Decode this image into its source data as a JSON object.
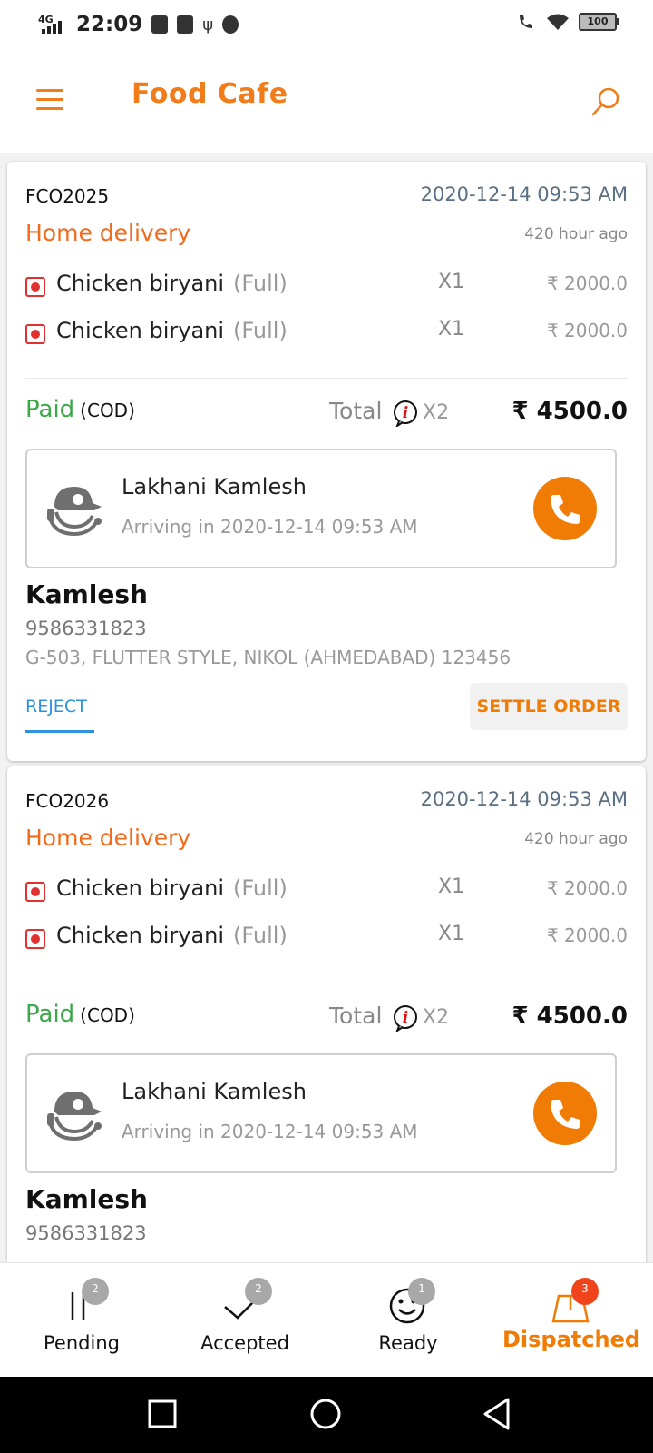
{
  "status_bar": {
    "network": "4G",
    "time": "22:09",
    "battery": "100"
  },
  "app_bar": {
    "title": "Food Cafe"
  },
  "orders": [
    {
      "id": "FCO2025",
      "date": "2020-12-14 09:53 AM",
      "type": "Home delivery",
      "ago": "420 hour ago",
      "items": [
        {
          "name": "Chicken biryani",
          "variant": "(Full)",
          "qty": "X1",
          "price": "₹ 2000.0"
        },
        {
          "name": "Chicken biryani",
          "variant": "(Full)",
          "qty": "X1",
          "price": "₹ 2000.0"
        }
      ],
      "payment_status": "Paid",
      "payment_method": "(COD)",
      "total_label": "Total",
      "total_count": "X2",
      "total_amount": "₹ 4500.0",
      "rider": {
        "name": "Lakhani Kamlesh",
        "eta": "Arriving in 2020-12-14 09:53 AM"
      },
      "customer": {
        "name": "Kamlesh",
        "phone": "9586331823",
        "address": "G-503, FLUTTER STYLE, NIKOL (AHMEDABAD) 123456"
      },
      "reject_label": "REJECT",
      "settle_label": "SETTLE ORDER"
    },
    {
      "id": "FCO2026",
      "date": "2020-12-14 09:53 AM",
      "type": "Home delivery",
      "ago": "420 hour ago",
      "items": [
        {
          "name": "Chicken biryani",
          "variant": "(Full)",
          "qty": "X1",
          "price": "₹ 2000.0"
        },
        {
          "name": "Chicken biryani",
          "variant": "(Full)",
          "qty": "X1",
          "price": "₹ 2000.0"
        }
      ],
      "payment_status": "Paid",
      "payment_method": "(COD)",
      "total_label": "Total",
      "total_count": "X2",
      "total_amount": "₹ 4500.0",
      "rider": {
        "name": "Lakhani Kamlesh",
        "eta": "Arriving in 2020-12-14 09:53 AM"
      },
      "customer": {
        "name": "Kamlesh",
        "phone": "9586331823"
      }
    }
  ],
  "bottom_nav": {
    "items": [
      {
        "label": "Pending",
        "badge": "2",
        "icon": "pause-icon"
      },
      {
        "label": "Accepted",
        "badge": "2",
        "icon": "check-icon"
      },
      {
        "label": "Ready",
        "badge": "1",
        "icon": "smiley-icon"
      },
      {
        "label": "Dispatched",
        "badge": "3",
        "icon": "delivery-box-icon",
        "active": true
      }
    ]
  },
  "colors": {
    "brand_orange": "#f07c06",
    "paid_green": "#3da84a",
    "reject_blue": "#2e93dc",
    "badge_red": "#f0451c"
  }
}
